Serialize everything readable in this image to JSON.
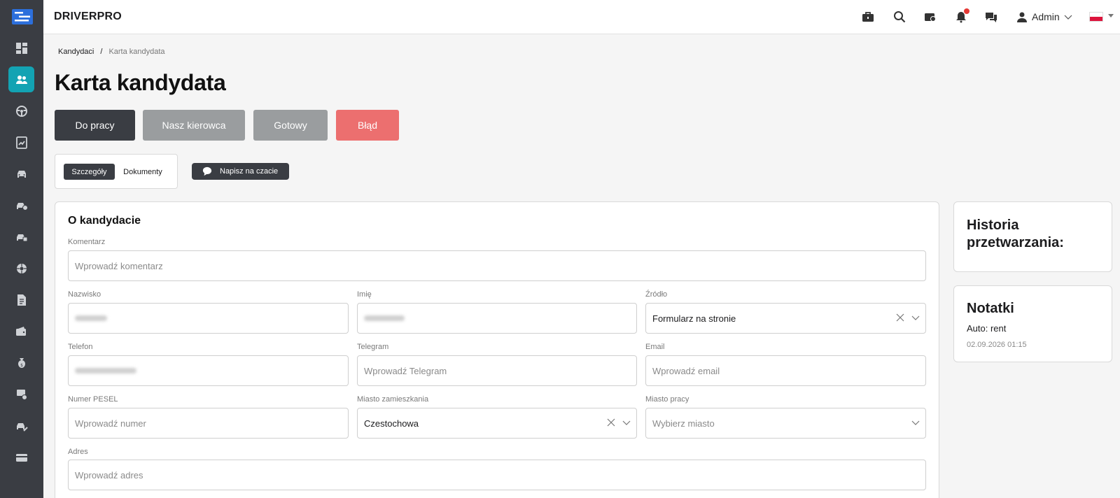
{
  "app": {
    "brand": "DRIVERPRO"
  },
  "header": {
    "user_name": "Admin"
  },
  "sidebar": {
    "items": [
      {
        "icon": "dashboard-icon",
        "active": false
      },
      {
        "icon": "users-icon",
        "active": true
      },
      {
        "icon": "steering-wheel-icon",
        "active": false
      },
      {
        "icon": "chart-icon",
        "active": false
      },
      {
        "icon": "car-icon",
        "active": false
      },
      {
        "icon": "car-dollar-icon",
        "active": false
      },
      {
        "icon": "car-check-icon",
        "active": false
      },
      {
        "icon": "wheel-icon",
        "active": false
      },
      {
        "icon": "document-icon",
        "active": false
      },
      {
        "icon": "wallet-icon",
        "active": false
      },
      {
        "icon": "money-bag-icon",
        "active": false
      },
      {
        "icon": "car-settings-icon",
        "active": false
      },
      {
        "icon": "car-tools-icon",
        "active": false
      },
      {
        "icon": "card-icon",
        "active": false
      }
    ]
  },
  "breadcrumb": {
    "parent": "Kandydaci",
    "separator": "/",
    "current": "Karta kandydata"
  },
  "page": {
    "title": "Karta kandydata"
  },
  "status_buttons": [
    {
      "label": "Do pracy",
      "color": "#3a3d43"
    },
    {
      "label": "Nasz kierowca",
      "color": "#9a9d9f"
    },
    {
      "label": "Gotowy",
      "color": "#9a9d9f"
    },
    {
      "label": "Błąd",
      "color": "#ec6f6f"
    }
  ],
  "tabs": [
    {
      "label": "Szczegóły",
      "active": true
    },
    {
      "label": "Dokumenty",
      "active": false
    }
  ],
  "chat_button": {
    "label": "Napisz na czacie"
  },
  "form": {
    "section_title": "O kandydacie",
    "comment": {
      "label": "Komentarz",
      "placeholder": "Wprowadź komentarz"
    },
    "last_name": {
      "label": "Nazwisko",
      "value": ""
    },
    "first_name": {
      "label": "Imię",
      "value": ""
    },
    "source": {
      "label": "Źródło",
      "value": "Formularz na stronie"
    },
    "phone": {
      "label": "Telefon",
      "value": ""
    },
    "telegram": {
      "label": "Telegram",
      "placeholder": "Wprowadź Telegram"
    },
    "email": {
      "label": "Email",
      "placeholder": "Wprowadź email"
    },
    "pesel": {
      "label": "Numer PESEL",
      "placeholder": "Wprowadź numer"
    },
    "city_residence": {
      "label": "Miasto zamieszkania",
      "value": "Czestochowa"
    },
    "city_work": {
      "label": "Miasto pracy",
      "placeholder": "Wybierz miasto"
    },
    "address": {
      "label": "Adres",
      "placeholder": "Wprowadź adres"
    }
  },
  "history": {
    "title": "Historia przetwarzania:"
  },
  "notes": {
    "title": "Notatki",
    "items": [
      {
        "text": "Auto: rent",
        "time": "02.09.2026 01:15"
      }
    ]
  },
  "colors": {
    "accent": "#13a3b3",
    "sidebar_bg": "#3a3d43",
    "notification": "#e53935"
  }
}
